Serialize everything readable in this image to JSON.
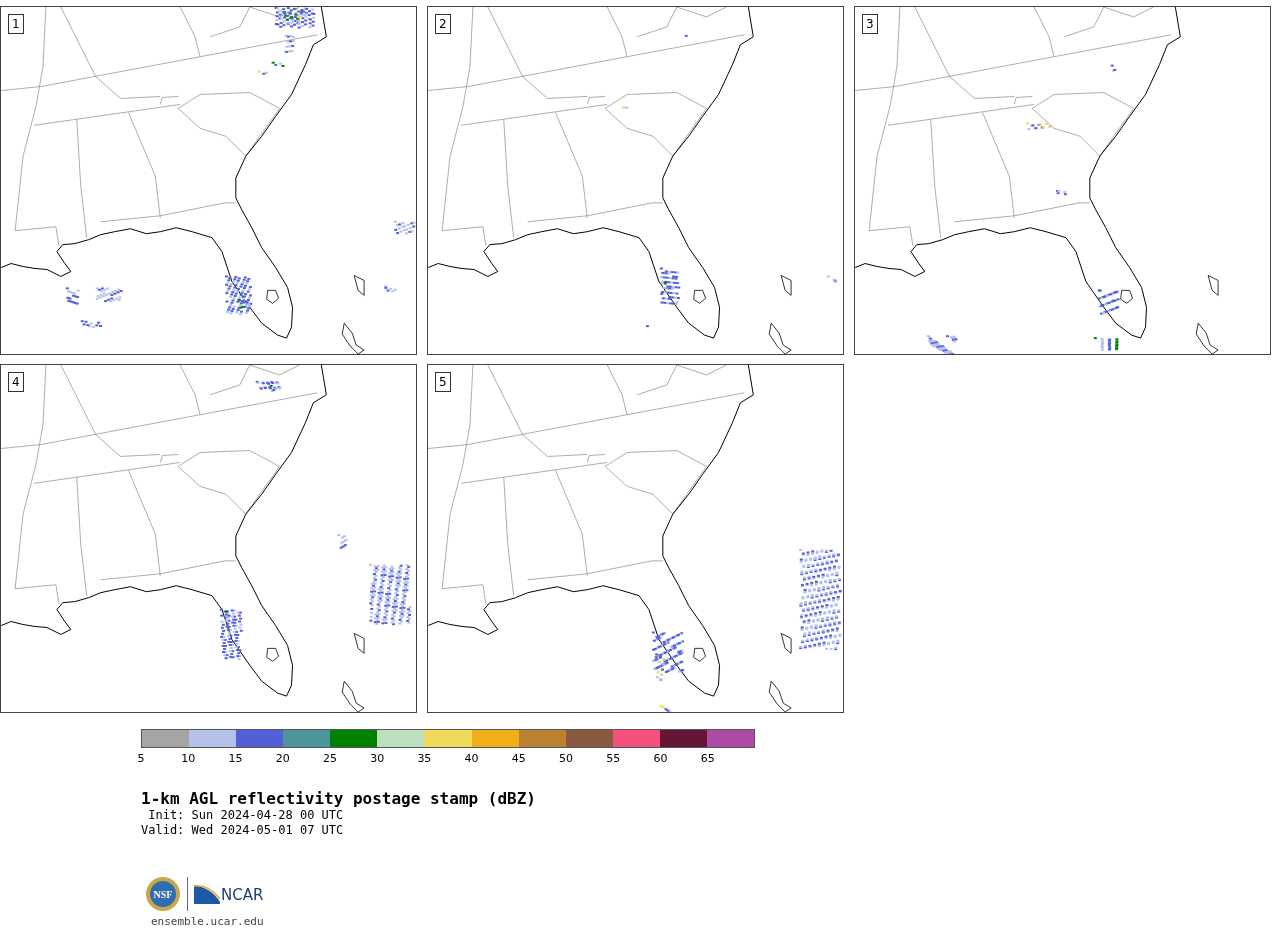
{
  "panels": [
    {
      "label": "1"
    },
    {
      "label": "2"
    },
    {
      "label": "3"
    },
    {
      "label": "4"
    },
    {
      "label": "5"
    }
  ],
  "colorbar": {
    "segments": [
      {
        "color": "#a5a5a5"
      },
      {
        "color": "#b6c1eb"
      },
      {
        "color": "#525fd6"
      },
      {
        "color": "#4e9599"
      },
      {
        "color": "#008200"
      },
      {
        "color": "#bedfbf"
      },
      {
        "color": "#f0da5c"
      },
      {
        "color": "#efae1a"
      },
      {
        "color": "#b98131"
      },
      {
        "color": "#8a5a40"
      },
      {
        "color": "#f4507d"
      },
      {
        "color": "#631636"
      },
      {
        "color": "#ac4aa5"
      }
    ],
    "ticks": [
      "5",
      "10",
      "15",
      "20",
      "25",
      "30",
      "35",
      "40",
      "45",
      "50",
      "55",
      "60",
      "65"
    ]
  },
  "title": "1-km AGL reflectivity postage stamp (dBZ)",
  "init": " Init: Sun 2024-04-28 00 UTC",
  "valid": "Valid: Wed 2024-05-01 07 UTC",
  "logo": {
    "nsf": "NSF",
    "ncar": "NCAR"
  },
  "site": "ensemble.ucar.edu"
}
